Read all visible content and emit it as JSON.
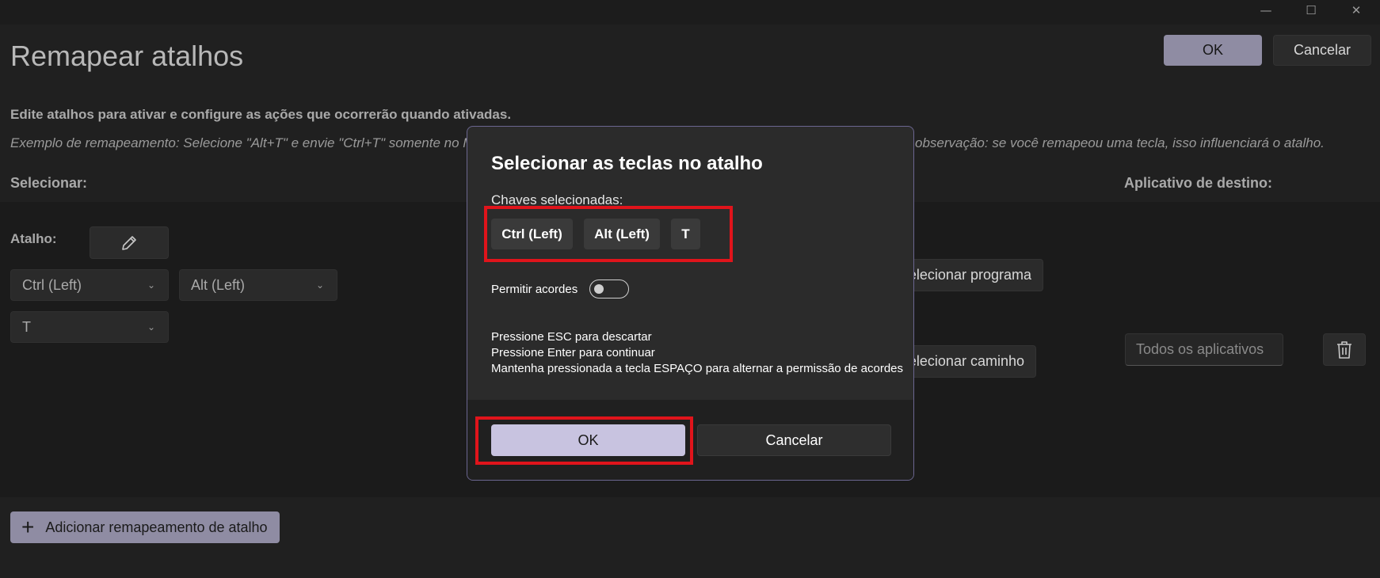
{
  "window": {
    "minimize_icon": "—",
    "maximize_icon": "☐",
    "close_icon": "✕"
  },
  "header": {
    "title": "Remapear atalhos",
    "ok_label": "OK",
    "cancel_label": "Cancelar"
  },
  "description": {
    "line1": "Edite atalhos para ativar e configure as ações que ocorrerão quando ativadas.",
    "example_left": "Exemplo de remapeamento: Selecione \"Alt+T\" e envie \"Ctrl+T\" somente no M",
    "example_right": "observação: se você remapeou uma tecla, isso influenciará o atalho."
  },
  "columns": {
    "select": "Selecionar:",
    "target_app": "Aplicativo de destino:"
  },
  "row": {
    "shortcut_label": "Atalho:",
    "key1": "Ctrl (Left)",
    "key2": "Alt (Left)",
    "key3": "T",
    "select_program": "elecionar programa",
    "select_path": "elecionar caminho",
    "target_placeholder": "Todos os aplicativos"
  },
  "footer": {
    "add_label": "Adicionar remapeamento de atalho"
  },
  "dialog": {
    "title": "Selecionar as teclas no atalho",
    "selected_keys_label": "Chaves selecionadas:",
    "keys": [
      "Ctrl (Left)",
      "Alt (Left)",
      "T"
    ],
    "allow_chords_label": "Permitir acordes",
    "allow_chords_on": false,
    "hint_esc": "Pressione ESC para descartar",
    "hint_enter": "Pressione Enter para continuar",
    "hint_space": "Mantenha pressionada a tecla ESPAÇO para alternar a permissão de acordes",
    "ok_label": "OK",
    "cancel_label": "Cancelar"
  },
  "colors": {
    "accent": "#8f8ca3",
    "dialog_accent": "#c8c3e0",
    "highlight": "#e0141b"
  }
}
